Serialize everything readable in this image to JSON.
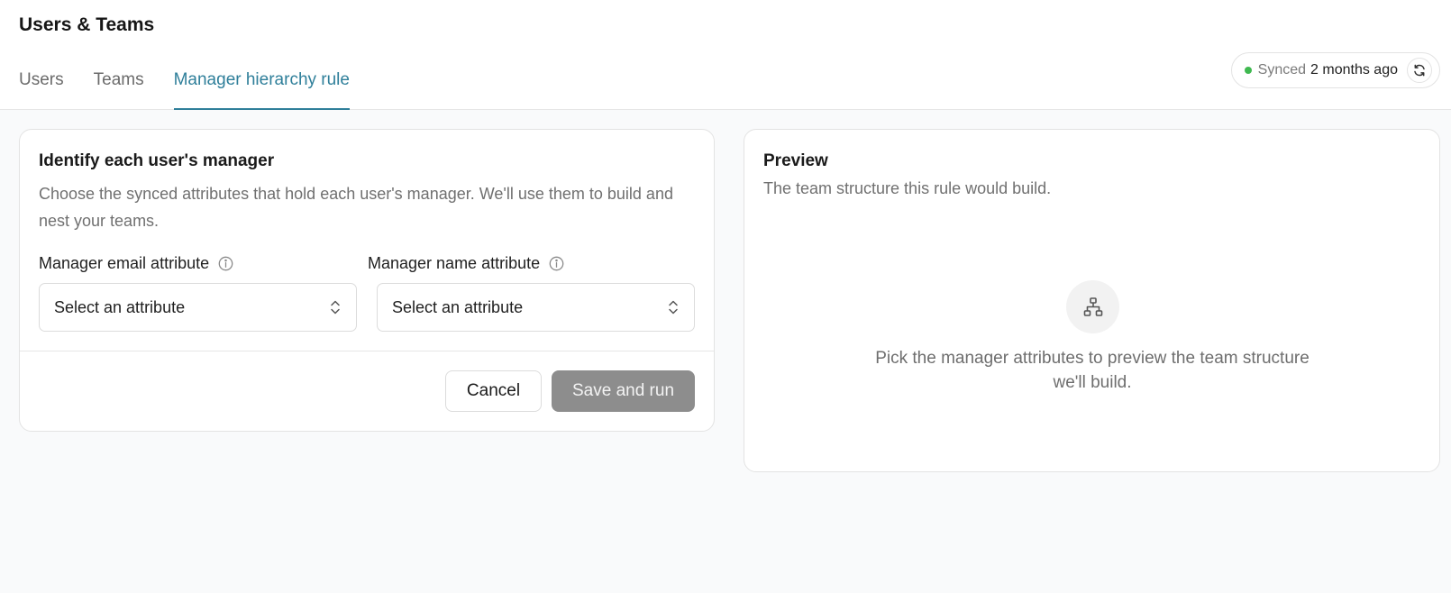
{
  "header": {
    "title": "Users & Teams",
    "tabs": [
      {
        "label": "Users",
        "active": false
      },
      {
        "label": "Teams",
        "active": false
      },
      {
        "label": "Manager hierarchy rule",
        "active": true
      }
    ],
    "sync": {
      "label": "Synced",
      "time": "2 months ago",
      "status_color": "#3fb950"
    }
  },
  "rule_card": {
    "title": "Identify each user's manager",
    "description": "Choose the synced attributes that hold each user's manager. We'll use them to build and nest your teams.",
    "email_field": {
      "label": "Manager email attribute",
      "value": "Select an attribute"
    },
    "name_field": {
      "label": "Manager name attribute",
      "value": "Select an attribute"
    },
    "cancel_label": "Cancel",
    "save_label": "Save and run"
  },
  "preview_card": {
    "title": "Preview",
    "description": "The team structure this rule would build.",
    "empty_message": "Pick the manager attributes to preview the team structure we'll build.",
    "icon": "hierarchy-icon"
  },
  "colors": {
    "accent": "#2f7f9a",
    "disabled_button": "#8d8d8d"
  }
}
